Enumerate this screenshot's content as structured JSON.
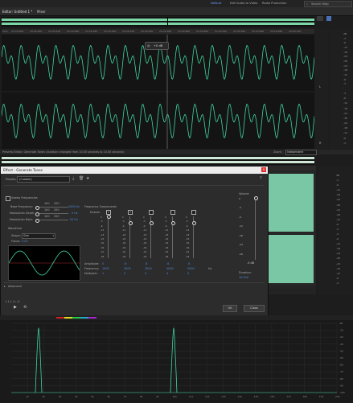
{
  "workspace": {
    "items": [
      "Default",
      "Edit Audio to Video",
      "Radio Production"
    ],
    "search_label": "Search Help"
  },
  "editor_tabs": [
    {
      "label": "Editor: Untitled 1 *"
    },
    {
      "label": "Mixer"
    }
  ],
  "timeline": {
    "time_format": "hms",
    "ruler_labels": [
      "23:20.400",
      "23:20.420",
      "23:20.440",
      "23:20.460",
      "23:20.480",
      "23:20.500",
      "23:20.520",
      "23:20.540",
      "23:20.560",
      "23:20.580",
      "23:20.600",
      "23:20.620",
      "23:20.640",
      "23:20.660",
      "23:20.680",
      "23:20.700",
      "23:20.720",
      "23:20.740",
      "23:20.760",
      "23:20.780"
    ],
    "gain_label": "+0 dB",
    "db_labels_top": [
      "dB",
      "-3",
      "-6",
      "-12",
      "-18",
      "-24",
      "-36",
      "-24",
      "-18",
      "-12",
      "-6",
      "-3"
    ],
    "db_labels_bottom": [
      "-3",
      "-6",
      "-12",
      "-18",
      "-24",
      "-36",
      "-24",
      "-18",
      "-12",
      "-6",
      "-3"
    ],
    "channel_markers": [
      "L",
      "R"
    ]
  },
  "preview_bar": {
    "label": "Preview Editor: Generate Tones (duration changed from 10.00 seconds to 10.00 seconds)",
    "zoom_label": "Zoom:",
    "zoom_value": "Independent"
  },
  "dialog": {
    "title": "Effect - Generate Tones",
    "presets_label": "Presets:",
    "presets_value": "(Custom)",
    "sweep_label": "Sweep Frequencies",
    "base_freq_label": "Base Frequency:",
    "base_freq_value": "1000 Hz",
    "mod_depth_label": "Modulation Depth:",
    "mod_depth_value": "0 Hz",
    "mod_rate_label": "Modulation Rate:",
    "mod_rate_value": "50 Hz",
    "slider_ticks": [
      "100",
      "200",
      "300"
    ],
    "waveform_label": "Waveform",
    "shape_label": "Shape:",
    "shape_value": "Sine",
    "flavor_label": "Flavor:",
    "flavor_value": "0.00",
    "freq_components_label": "Frequency Components",
    "enable_label": "Enable:",
    "component_enabled": [
      true,
      true,
      false,
      false,
      false
    ],
    "component_scale": [
      "0",
      "-3",
      "-6",
      "-12",
      "-18",
      "-24",
      "-30",
      "-36",
      "-42",
      "-48"
    ],
    "amplitude_label": "Amplitude:",
    "amplitude_values": [
      "0",
      "-6",
      "-6",
      "-6",
      "-6"
    ],
    "frequency_label": "Frequency:",
    "frequency_values": [
      "1000",
      "2000",
      "3000",
      "4000",
      "5000"
    ],
    "multiplier_label": "Multiplier:",
    "multiplier_values": [
      "1",
      "2",
      "3",
      "4",
      "5"
    ],
    "hz_unit": "Hz",
    "volume_label": "Volume",
    "volume_scale": [
      "0",
      "-3",
      "-6",
      "-12",
      "-18",
      "-24",
      "-36"
    ],
    "volume_value": "-3 dB",
    "duration_label": "Duration:",
    "duration_value": "10.000",
    "advanced_label": "Advanced",
    "ok_label": "OK",
    "close_label": "Close"
  },
  "transport": {
    "channel_label": "L  L  L / L / L"
  },
  "analysis": {
    "x_ticks": [
      "1k",
      "2k",
      "3k",
      "4k",
      "5k",
      "6k",
      "7k",
      "8k",
      "9k",
      "10k",
      "11k",
      "12k",
      "13k",
      "14k",
      "15k",
      "16k",
      "17k",
      "18k",
      "19k",
      "20k"
    ],
    "y_ticks": [
      "dB",
      "-10",
      "-20",
      "-30",
      "-40",
      "-50",
      "-60",
      "-70",
      "-80",
      "-90",
      "-100"
    ],
    "peaks_hz": [
      1000,
      10000
    ]
  },
  "colors": {
    "waveform": "#3fd6a0",
    "accent": "#4d8bd8",
    "overview": "#7ad6a6",
    "panel_bg": "#141414"
  }
}
